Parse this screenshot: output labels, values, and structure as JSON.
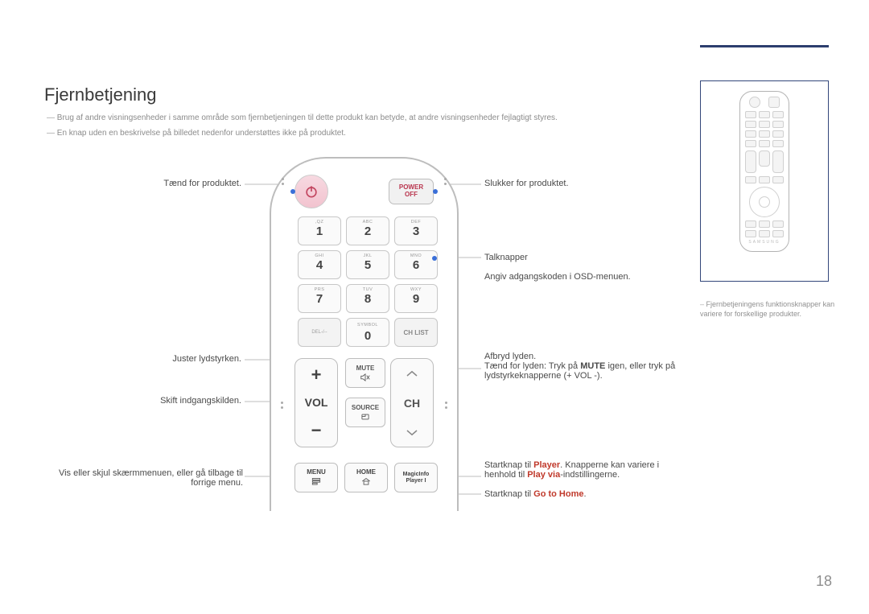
{
  "title": "Fjernbetjening",
  "notes": {
    "n1": "Brug af andre visningsenheder i samme område som fjernbetjeningen til dette produkt kan betyde, at andre visningsenheder fejlagtigt styres.",
    "n2": "En knap uden en beskrivelse på billedet nedenfor understøttes ikke på produktet."
  },
  "remote": {
    "power_off": {
      "l1": "POWER",
      "l2": "OFF"
    },
    "keys": {
      "k1": {
        "num": "1",
        "sub": ",QZ"
      },
      "k2": {
        "num": "2",
        "sub": "ABC"
      },
      "k3": {
        "num": "3",
        "sub": "DEF"
      },
      "k4": {
        "num": "4",
        "sub": "GHI"
      },
      "k5": {
        "num": "5",
        "sub": "JKL"
      },
      "k6": {
        "num": "6",
        "sub": "MNO"
      },
      "k7": {
        "num": "7",
        "sub": "PRS"
      },
      "k8": {
        "num": "8",
        "sub": "TUV"
      },
      "k9": {
        "num": "9",
        "sub": "WXY"
      },
      "del": "DEL-/--",
      "sym_top": "SYMBOL",
      "zero": "0",
      "chlist": "CH LIST"
    },
    "vol": {
      "plus": "+",
      "label": "VOL",
      "minus": "−"
    },
    "ch": {
      "label": "CH"
    },
    "mute": "MUTE",
    "source": "SOURCE",
    "menu": "MENU",
    "home": "HOME",
    "magicinfo": {
      "l1": "MagicInfo",
      "l2": "Player I"
    }
  },
  "callouts": {
    "left": {
      "c1": "Tænd for produktet.",
      "c2": "Juster lydstyrken.",
      "c3": "Skift indgangskilden.",
      "c4a": "Vis eller skjul skærmmenuen, eller gå tilbage til",
      "c4b": "forrige menu."
    },
    "right": {
      "c1": "Slukker for produktet.",
      "c2a": "Talknapper",
      "c2b": "Angiv adgangskoden i OSD-menuen.",
      "c3a": "Afbryd lyden.",
      "c3b_pre": "Tænd for lyden: Tryk på ",
      "c3b_bold": "MUTE",
      "c3b_post": " igen, eller tryk på",
      "c3c": "lydstyrkeknapperne (+ VOL -).",
      "c4_pre": "Startknap til ",
      "c4_red1": "Player",
      "c4_mid": ". Knapperne kan variere i",
      "c4b_pre": "henhold til ",
      "c4b_red": "Play via",
      "c4b_post": "-indstillingerne.",
      "c5_pre": "Startknap til ",
      "c5_red": "Go to Home",
      "c5_post": "."
    }
  },
  "panel_note": "Fjernbetjeningens funktionsknapper kan variere for forskellige produkter.",
  "page_number": "18",
  "mini_brand": "SAMSUNG"
}
